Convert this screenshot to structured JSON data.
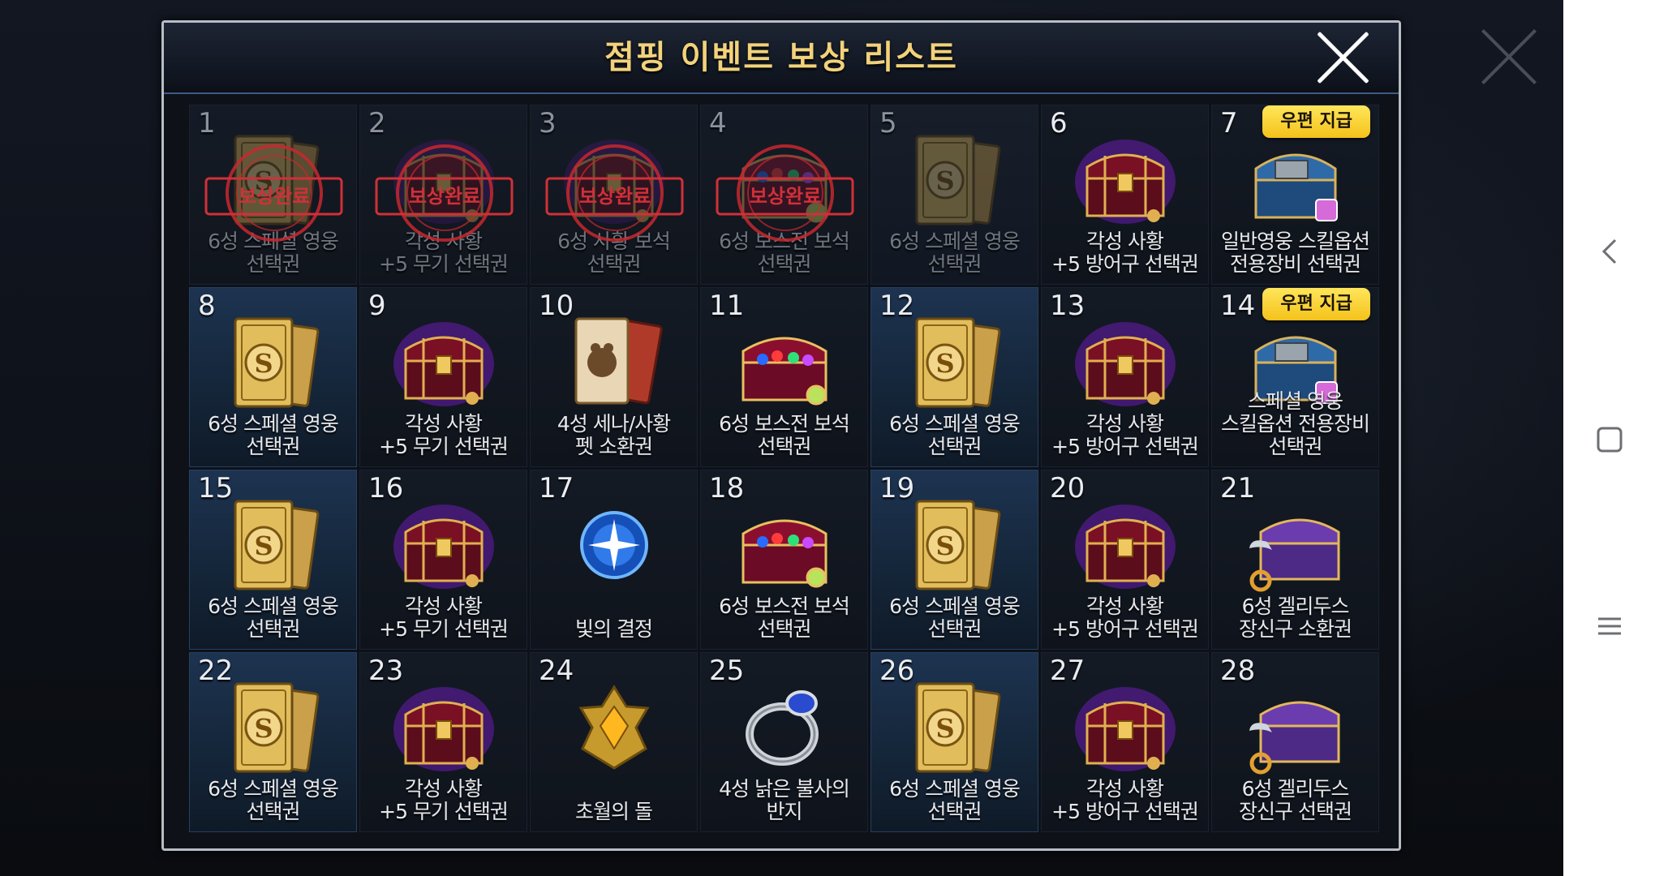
{
  "dialog": {
    "title": "점핑 이벤트 보상 리스트"
  },
  "stamp_text": "보상완료",
  "badge_text": "우편 지급",
  "items": [
    {
      "num": "1",
      "label": "6성 스페셜 영웅\n선택권",
      "icon": "ticket-icon",
      "state": "claimed"
    },
    {
      "num": "2",
      "label": "각성 사황\n+5 무기 선택권",
      "icon": "chest-icon",
      "state": "claimed"
    },
    {
      "num": "3",
      "label": "6성 사황 보석\n선택권",
      "icon": "chest-icon",
      "state": "claimed"
    },
    {
      "num": "4",
      "label": "6성 보스전 보석\n선택권",
      "icon": "gem-chest-icon",
      "state": "claimed"
    },
    {
      "num": "5",
      "label": "6성 스페셜 영웅\n선택권",
      "icon": "ticket-icon",
      "state": "dim"
    },
    {
      "num": "6",
      "label": "각성 사황\n+5 방어구 선택권",
      "icon": "chest-icon",
      "state": "normal"
    },
    {
      "num": "7",
      "label": "일반영웅 스킬옵션\n전용장비 선택권",
      "icon": "blue-chest-icon",
      "state": "normal",
      "badge": true
    },
    {
      "num": "8",
      "label": "6성 스페셜 영웅\n선택권",
      "icon": "ticket-icon",
      "state": "ticket"
    },
    {
      "num": "9",
      "label": "각성 사황\n+5 무기 선택권",
      "icon": "chest-icon",
      "state": "normal"
    },
    {
      "num": "10",
      "label": "4성 세나/사황\n펫 소환권",
      "icon": "pet-card-icon",
      "state": "normal"
    },
    {
      "num": "11",
      "label": "6성 보스전 보석\n선택권",
      "icon": "gem-chest-icon",
      "state": "normal"
    },
    {
      "num": "12",
      "label": "6성 스페셜 영웅\n선택권",
      "icon": "ticket-icon",
      "state": "ticket"
    },
    {
      "num": "13",
      "label": "각성 사황\n+5 방어구 선택권",
      "icon": "chest-icon",
      "state": "normal"
    },
    {
      "num": "14",
      "label": "스페셜 영웅\n스킬옵션 전용장비\n선택권",
      "icon": "blue-chest-icon",
      "state": "normal",
      "badge": true
    },
    {
      "num": "15",
      "label": "6성 스페셜 영웅\n선택권",
      "icon": "ticket-icon",
      "state": "ticket"
    },
    {
      "num": "16",
      "label": "각성 사황\n+5 무기 선택권",
      "icon": "chest-icon",
      "state": "normal"
    },
    {
      "num": "17",
      "label": "빛의 결정",
      "icon": "light-crystal-icon",
      "state": "normal"
    },
    {
      "num": "18",
      "label": "6성 보스전 보석\n선택권",
      "icon": "gem-chest-icon",
      "state": "normal"
    },
    {
      "num": "19",
      "label": "6성 스페셜 영웅\n선택권",
      "icon": "ticket-icon",
      "state": "ticket"
    },
    {
      "num": "20",
      "label": "각성 사황\n+5 방어구 선택권",
      "icon": "chest-icon",
      "state": "normal"
    },
    {
      "num": "21",
      "label": "6성 겔리두스\n장신구 소환권",
      "icon": "purple-chest-icon",
      "state": "normal"
    },
    {
      "num": "22",
      "label": "6성 스페셜 영웅\n선택권",
      "icon": "ticket-icon",
      "state": "ticket"
    },
    {
      "num": "23",
      "label": "각성 사황\n+5 무기 선택권",
      "icon": "chest-icon",
      "state": "normal"
    },
    {
      "num": "24",
      "label": "초월의 돌",
      "icon": "transcend-stone-icon",
      "state": "normal"
    },
    {
      "num": "25",
      "label": "4성 낡은 불사의\n반지",
      "icon": "ring-icon",
      "state": "normal"
    },
    {
      "num": "26",
      "label": "6성 스페셜 영웅\n선택권",
      "icon": "ticket-icon",
      "state": "ticket"
    },
    {
      "num": "27",
      "label": "각성 사황\n+5 방어구 선택권",
      "icon": "chest-icon",
      "state": "normal"
    },
    {
      "num": "28",
      "label": "6성 겔리두스\n장신구 선택권",
      "icon": "purple-chest-icon",
      "state": "normal"
    }
  ],
  "navbar": {
    "back_icon": "chevron-left-icon",
    "home_icon": "square-icon",
    "recent_icon": "menu-icon"
  }
}
